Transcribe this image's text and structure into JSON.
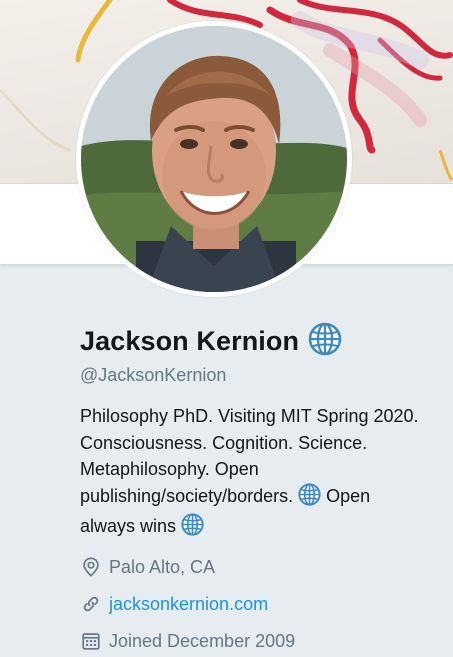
{
  "profile": {
    "name": "Jackson Kernion",
    "handle": "@JacksonKernion",
    "bio": {
      "text": "Philosophy PhD. Visiting MIT Spring 2020. Consciousness. Cognition. Science. Metaphilosophy. Open publishing/society/borders.",
      "tail": "Open always wins"
    },
    "location": "Palo Alto, CA",
    "website": "jacksonkernion.com",
    "joined": "Joined December 2009"
  },
  "icons": {
    "name_badge": "globe-emoji-icon",
    "location": "location-pin-icon",
    "website": "link-icon",
    "joined": "calendar-icon"
  },
  "colors": {
    "page_background": "#e6ecf0",
    "primary_text": "#14171a",
    "secondary_text": "#657786",
    "link": "#1b95e0"
  }
}
